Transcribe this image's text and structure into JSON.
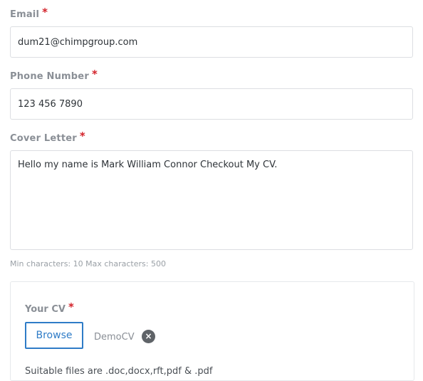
{
  "email": {
    "label": "Email",
    "required_mark": "*",
    "value": "dum21@chimpgroup.com"
  },
  "phone": {
    "label": "Phone Number",
    "required_mark": "*",
    "value": "123 456 7890"
  },
  "cover_letter": {
    "label": "Cover Letter",
    "required_mark": "*",
    "value": "Hello my name is Mark William Connor Checkout My CV.",
    "hint": "Min characters: 10 Max characters: 500"
  },
  "cv": {
    "label": "Your CV",
    "required_mark": "*",
    "browse_label": "Browse",
    "file_name": "DemoCV",
    "remove_symbol": "×",
    "suitable_files": "Suitable files are .doc,docx,rft,pdf & .pdf"
  },
  "colors": {
    "required": "#d3222a",
    "accent": "#2f7cc7",
    "label": "#8a8f96"
  }
}
